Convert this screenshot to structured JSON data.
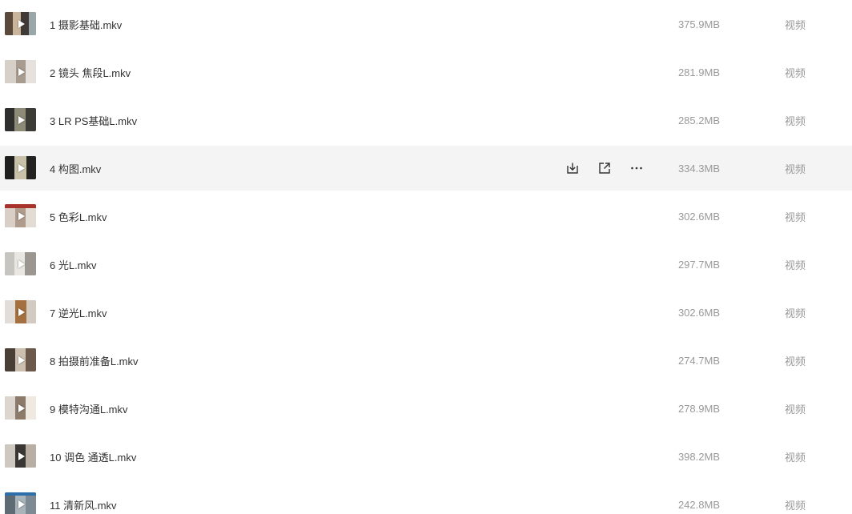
{
  "files": [
    {
      "name": "1 摄影基础.mkv",
      "size": "375.9MB",
      "type": "视频"
    },
    {
      "name": "2 镜头 焦段L.mkv",
      "size": "281.9MB",
      "type": "视频"
    },
    {
      "name": "3 LR PS基础L.mkv",
      "size": "285.2MB",
      "type": "视频"
    },
    {
      "name": "4 构图.mkv",
      "size": "334.3MB",
      "type": "视频"
    },
    {
      "name": "5 色彩L.mkv",
      "size": "302.6MB",
      "type": "视频"
    },
    {
      "name": "6 光L.mkv",
      "size": "297.7MB",
      "type": "视频"
    },
    {
      "name": "7 逆光L.mkv",
      "size": "302.6MB",
      "type": "视频"
    },
    {
      "name": "8 拍摄前准备L.mkv",
      "size": "274.7MB",
      "type": "视频"
    },
    {
      "name": "9 模特沟通L.mkv",
      "size": "278.9MB",
      "type": "视频"
    },
    {
      "name": "10 调色 通透L.mkv",
      "size": "398.2MB",
      "type": "视频"
    },
    {
      "name": "11 清新风.mkv",
      "size": "242.8MB",
      "type": "视频"
    }
  ],
  "hovered_row": 3,
  "row_actions": [
    "download-icon",
    "share-icon",
    "more-icon"
  ]
}
